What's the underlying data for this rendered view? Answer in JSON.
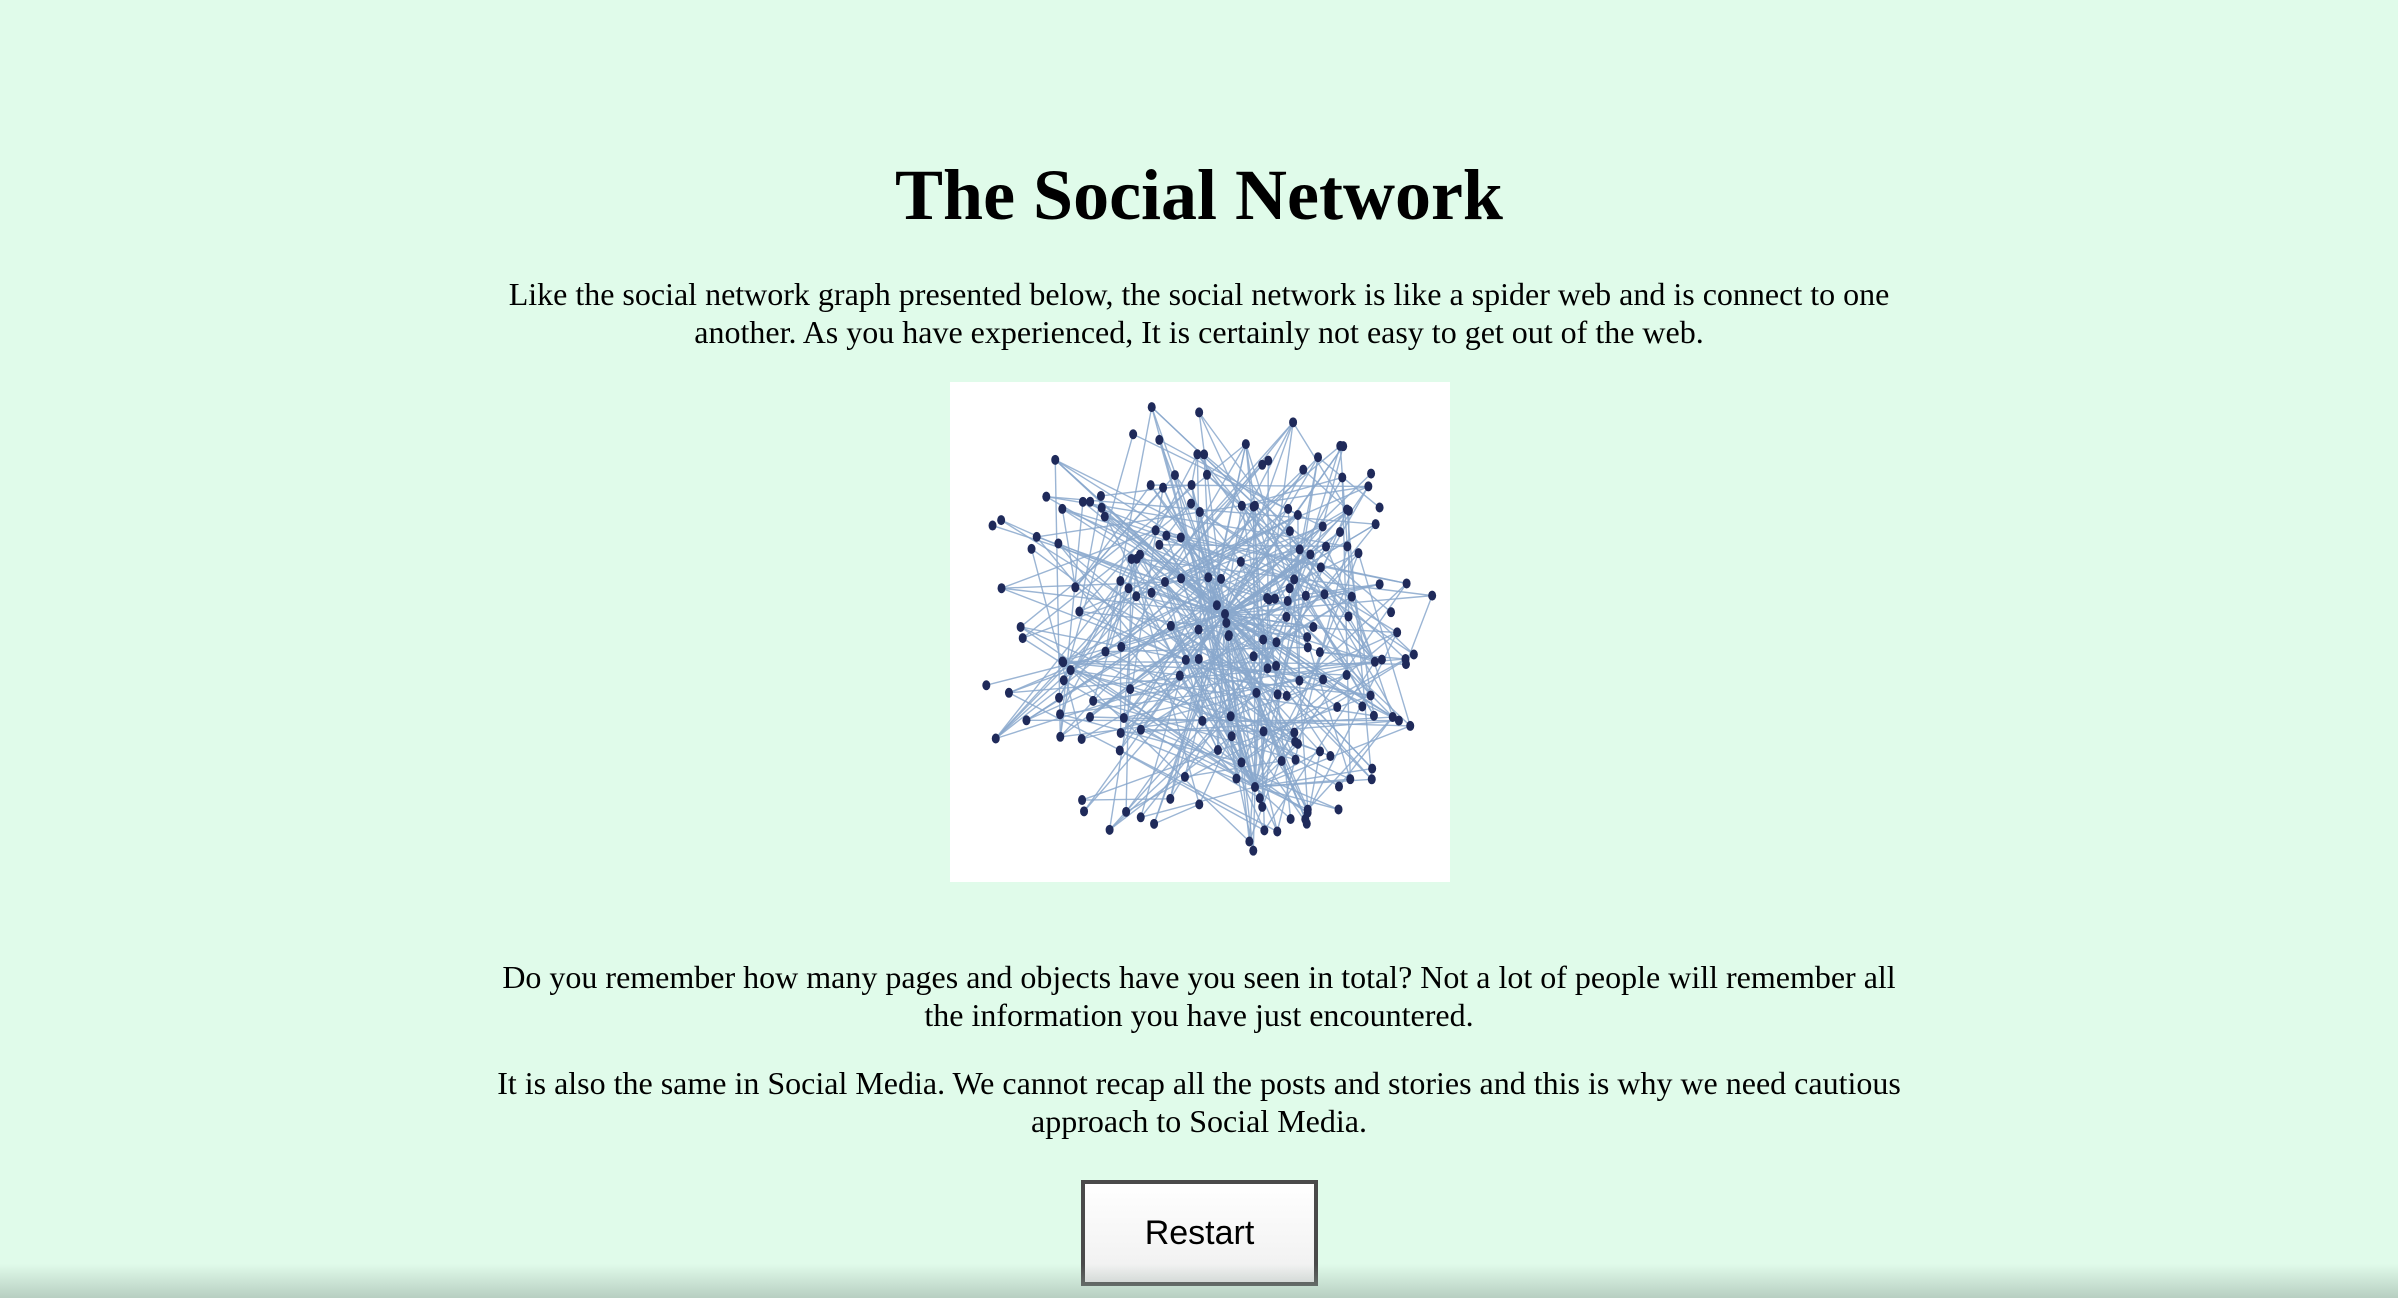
{
  "page": {
    "title": "The Social Network",
    "intro": "Like the social network graph presented below, the social network is like a spider web and is connect to one another. As you have experienced, It is certainly not easy to get out of the web.",
    "question": "Do you remember how many pages and objects have you seen in total? Not a lot of people will remember all the information you have just encountered.",
    "conclusion": "It is also the same in Social Media. We cannot recap all the posts and stories and this is why we need cautious approach to Social Media.",
    "restart_label": "Restart"
  },
  "image": {
    "subject": "social-network-graph",
    "node_color": "#1f2a5a",
    "edge_color": "#8aa8cc",
    "background": "#ffffff"
  },
  "colors": {
    "page_background": "#e0fbea",
    "button_border": "#4a4a4a"
  }
}
